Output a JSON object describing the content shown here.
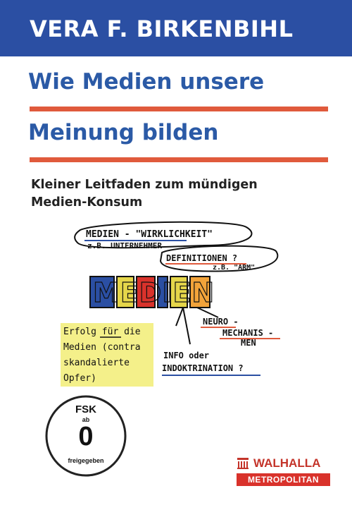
{
  "author": "VERA F. BIRKENBIHL",
  "title_line1": "Wie Medien unsere",
  "title_line2": "Meinung bilden",
  "subtitle_line1": "Kleiner Leitfaden zum mündigen",
  "subtitle_line2": "Medien-Konsum",
  "sketch": {
    "bubble1_line1": "MEDIEN - \"WIRKLICHKEIT\"",
    "bubble1_line2": "z.B. UNTERNEHMER",
    "definitions": "DEFINITIONEN ?",
    "definitions_sub": "z.B. \"ARM\"",
    "medien": "MEDIEN",
    "neuro_line1": "NEURO -",
    "neuro_line2": "MECHANIS -",
    "neuro_line3": "MEN",
    "left_line1": "Erfolg für die",
    "left_line2": "Medien (contra",
    "left_line3": "skandalierte",
    "left_line4": "Opfer)",
    "info_line1": "INFO oder",
    "info_line2": "INDOKTRINATION ?"
  },
  "fsk": {
    "label": "FSK",
    "ab": "ab",
    "age": "0",
    "freigegeben": "freigegeben"
  },
  "publisher": {
    "name": "WALHALLA",
    "sub": "METROPOLITAN"
  },
  "colors": {
    "banner_blue": "#2b4fa3",
    "title_blue": "#2b5aa6",
    "accent_red": "#e05a3c",
    "publisher_red": "#d9322b",
    "highlight_yellow": "#f4f08a"
  }
}
